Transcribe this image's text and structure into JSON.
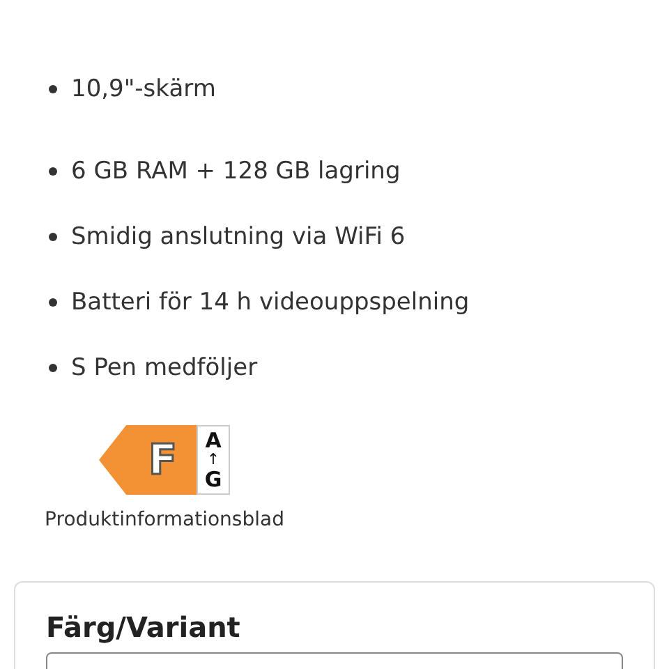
{
  "features": [
    "10,9\"-skärm",
    "6 GB RAM + 128 GB lagring",
    "Smidig anslutning via WiFi 6",
    "Batteri för 14 h videouppspelning",
    "S Pen medföljer"
  ],
  "energy_label": {
    "rating": "F",
    "scale_top": "A",
    "scale_arrow": "↑",
    "scale_bottom": "G",
    "caption": "Produktinformationsblad"
  },
  "variant_card": {
    "title": "Färg/Variant"
  }
}
